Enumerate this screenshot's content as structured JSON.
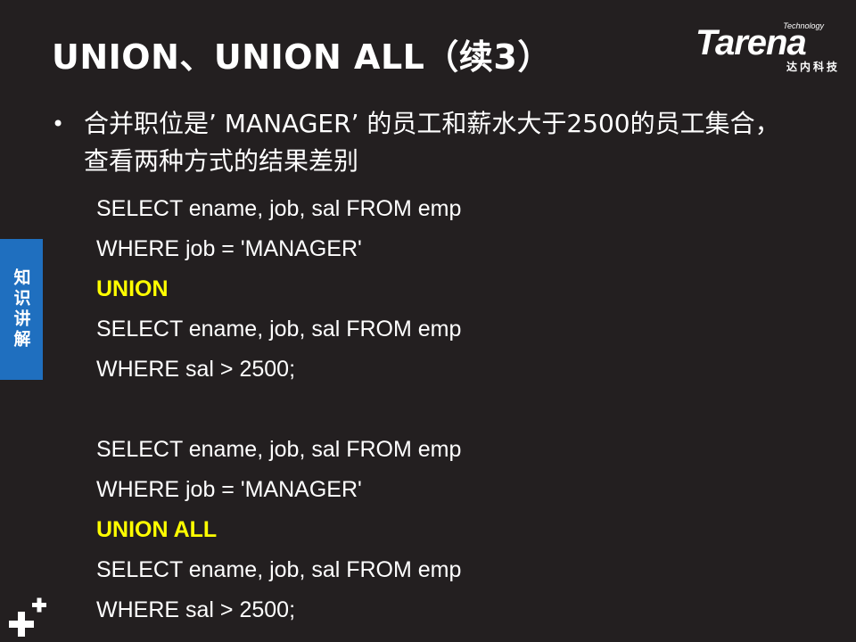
{
  "slide": {
    "title": "UNION、UNION ALL（续3）",
    "logo": {
      "technology": "Technology",
      "word": "Tarena",
      "chinese": "达内科技"
    },
    "bullet": "合并职位是’ MANAGER’ 的员工和薪水大于2500的员工集合，查看两种方式的结果差别",
    "code_lines": [
      {
        "text": "SELECT ename, job, sal FROM emp",
        "keyword": false
      },
      {
        "text": "WHERE job = 'MANAGER'",
        "keyword": false
      },
      {
        "text": "UNION",
        "keyword": true
      },
      {
        "text": "SELECT ename, job, sal FROM emp",
        "keyword": false
      },
      {
        "text": "WHERE sal > 2500;",
        "keyword": false
      },
      {
        "text": "",
        "keyword": false
      },
      {
        "text": "SELECT ename, job, sal FROM emp",
        "keyword": false
      },
      {
        "text": "WHERE job = 'MANAGER'",
        "keyword": false
      },
      {
        "text": "UNION ALL",
        "keyword": true
      },
      {
        "text": "SELECT ename, job, sal FROM emp",
        "keyword": false
      },
      {
        "text": "WHERE sal > 2500;",
        "keyword": false
      }
    ],
    "side_tab": "知识讲解",
    "colors": {
      "background": "#231f20",
      "keyword": "#ffff00",
      "side_tab": "#1f6fbf"
    }
  }
}
